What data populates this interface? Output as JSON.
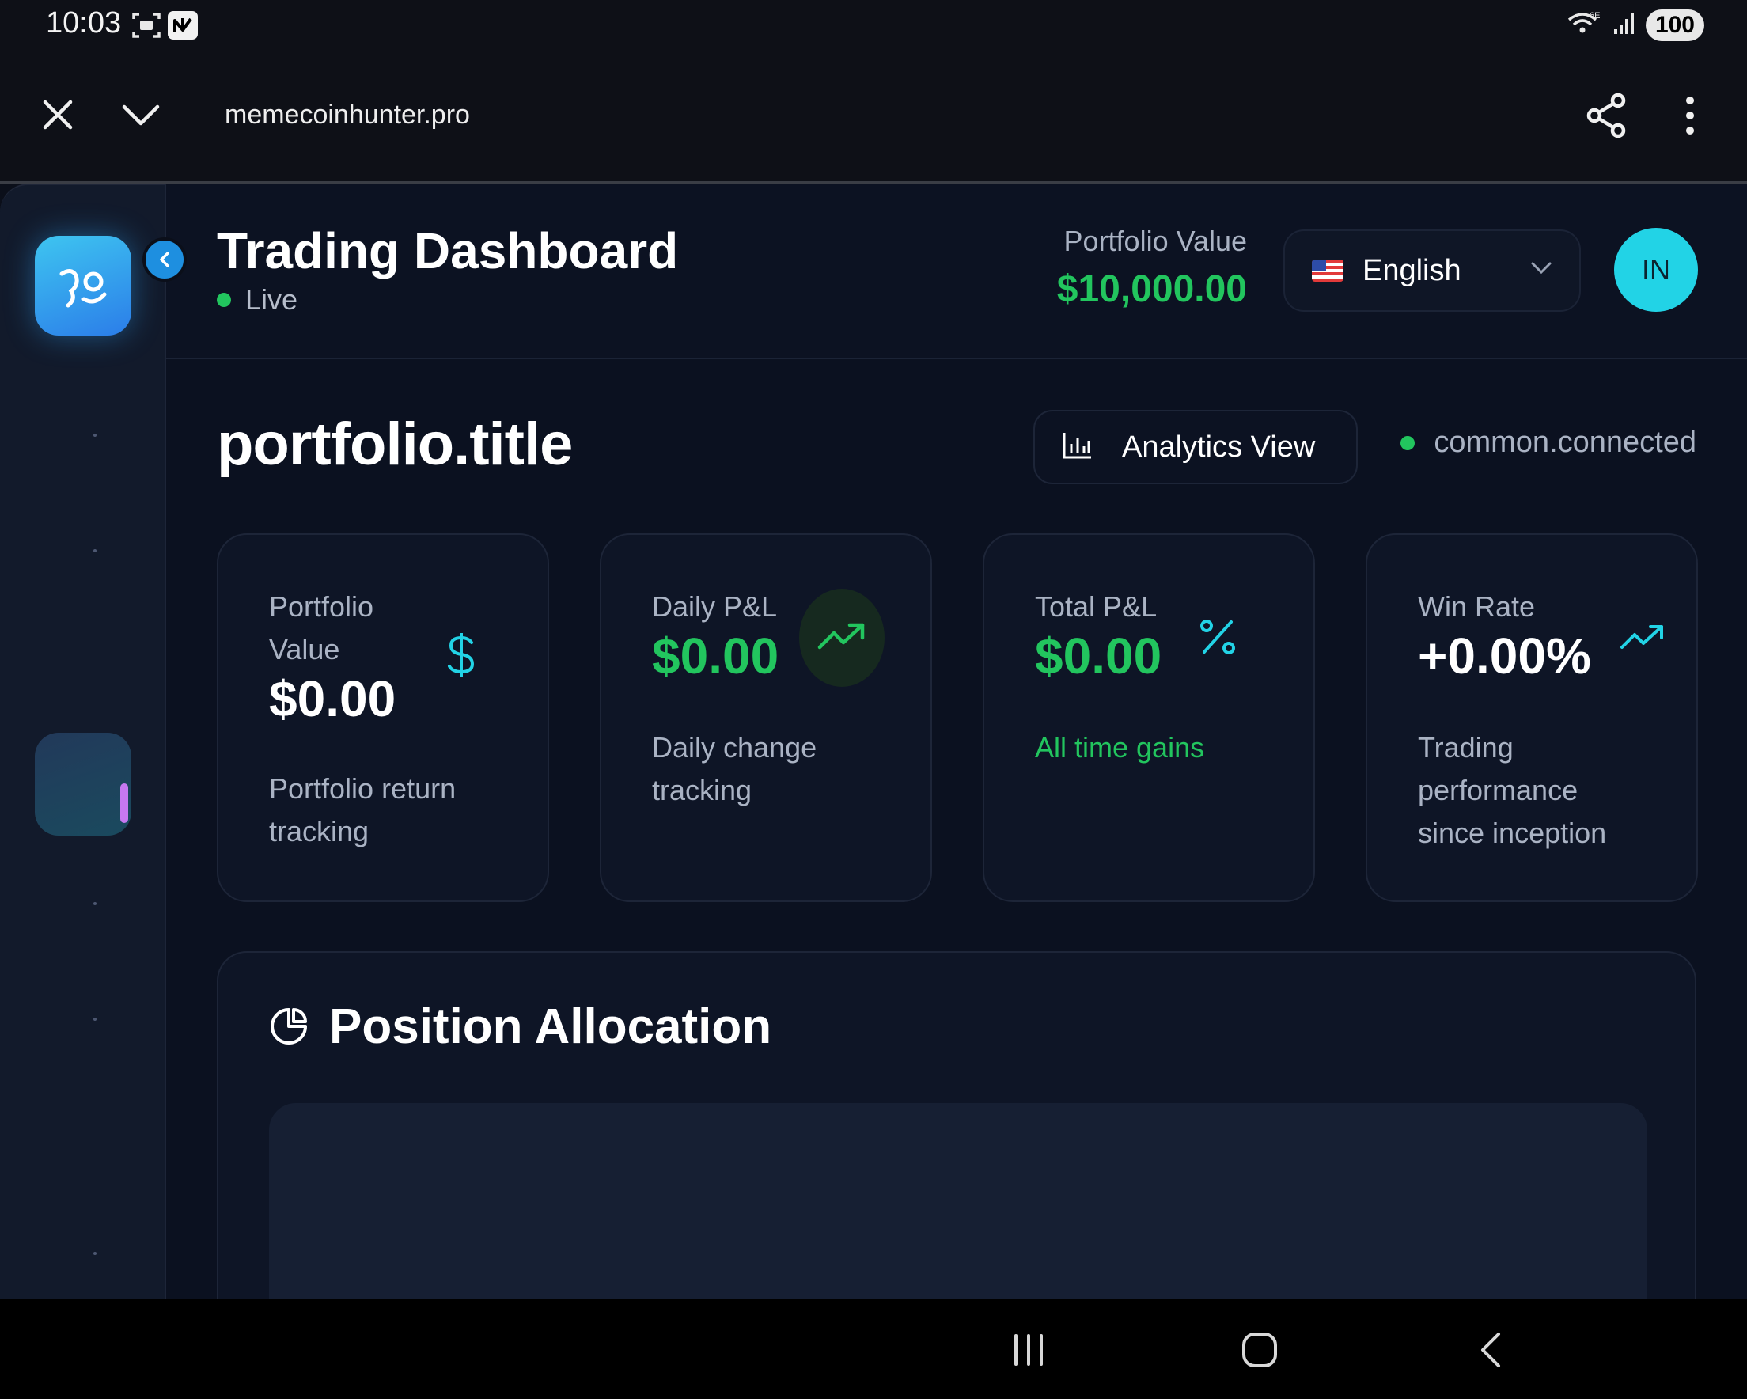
{
  "status_bar": {
    "time": "10:03",
    "network": "6E",
    "battery": "100"
  },
  "browser": {
    "url": "memecoinhunter.pro"
  },
  "header": {
    "title": "Trading Dashboard",
    "live_label": "Live",
    "portfolio_label": "Portfolio Value",
    "portfolio_value": "$10,000.00",
    "language": "English",
    "avatar_initials": "IN"
  },
  "section": {
    "title": "portfolio.title",
    "analytics_button": "Analytics View",
    "connection_status": "common.connected"
  },
  "cards": [
    {
      "label_line1": "Portfolio",
      "label_line2": "Value",
      "value": "$0.00",
      "desc_line1": "Portfolio return",
      "desc_line2": "tracking",
      "icon": "dollar-icon"
    },
    {
      "label": "Daily P&L",
      "value": "$0.00",
      "desc_line1": "Daily change",
      "desc_line2": "tracking",
      "icon": "trending-up-icon"
    },
    {
      "label": "Total P&L",
      "value": "$0.00",
      "desc": "All time gains",
      "icon": "percent-icon"
    },
    {
      "label": "Win Rate",
      "value": "+0.00%",
      "desc_line1": "Trading",
      "desc_line2": "performance",
      "desc_line3": "since inception",
      "icon": "trending-up-icon"
    }
  ],
  "allocation": {
    "title": "Position Allocation",
    "icon": "pie-chart-icon"
  },
  "colors": {
    "accent_green": "#22c55e",
    "accent_cyan": "#22d3e6",
    "background": "#0b1120",
    "card": "#0e1526"
  }
}
